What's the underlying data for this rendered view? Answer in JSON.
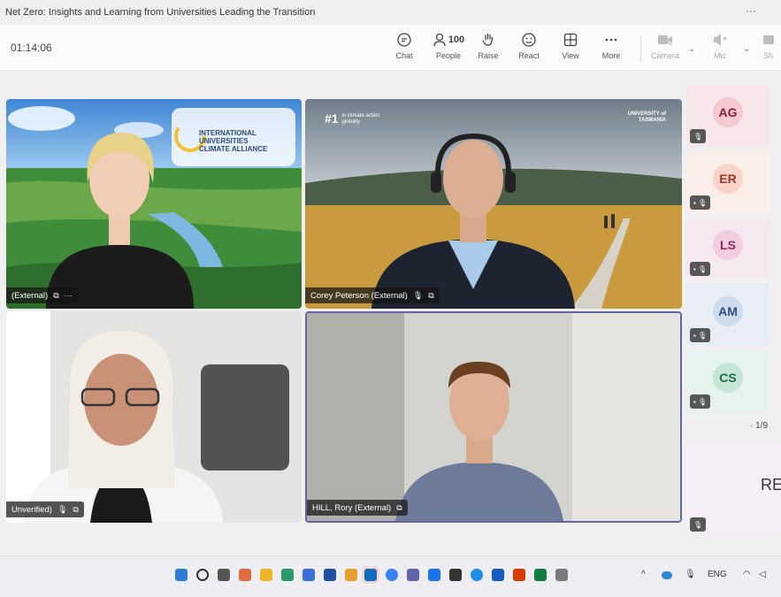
{
  "window": {
    "title": "Net Zero: Insights and Learning from Universities Leading the Transition",
    "menu_dots": "···"
  },
  "toolbar": {
    "timer": "01:14:06",
    "chat": "Chat",
    "people": "People",
    "people_count": "100",
    "raise": "Raise",
    "react": "React",
    "view": "View",
    "more": "More",
    "camera": "Camera",
    "mic": "Mic",
    "share": "Sh"
  },
  "tiles": [
    {
      "name": "(External)",
      "logo_lines": [
        "INTERNATIONAL",
        "UNIVERSITIES",
        "CLIMATE ALLIANCE"
      ]
    },
    {
      "name": "Corey Peterson (External)",
      "brand_left": "#1",
      "brand_left_sub": "in climate action globally",
      "brand_right": "UNIVERSITY of TASMANIA"
    },
    {
      "name": "Unverified)"
    },
    {
      "name": "HILL, Rory (External)"
    }
  ],
  "sidebar": [
    {
      "initials": "AG",
      "bg": "#f7e7ea",
      "circle": "#f4c9cf",
      "fg": "#8b2030"
    },
    {
      "initials": "ER",
      "bg": "#fbeee8",
      "circle": "#f7d3c8",
      "fg": "#a0352a"
    },
    {
      "initials": "LS",
      "bg": "#f6e8ef",
      "circle": "#f2cde0",
      "fg": "#8c2a57"
    },
    {
      "initials": "AM",
      "bg": "#e9eef6",
      "circle": "#cfdcee",
      "fg": "#2d4f80"
    },
    {
      "initials": "CS",
      "bg": "#e6f3ee",
      "circle": "#c5e6d7",
      "fg": "#1e6a47"
    }
  ],
  "pager": "1/9",
  "large_tile_initials": "RE",
  "taskbar": {
    "lang": "ENG"
  }
}
